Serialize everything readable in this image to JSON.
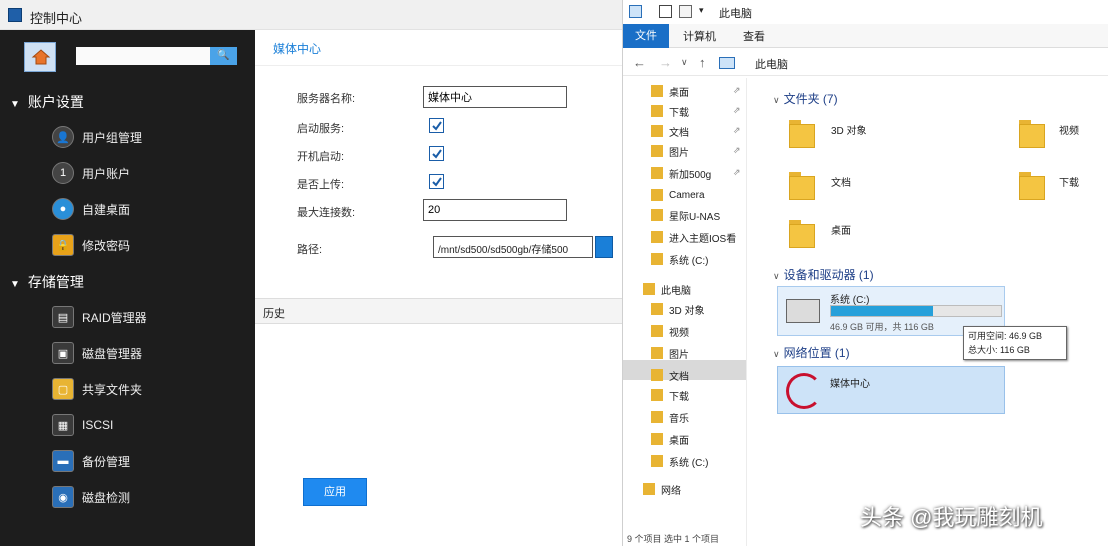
{
  "left_window": {
    "title": "控制中心",
    "search": {
      "placeholder": "",
      "button_label": "🔍"
    },
    "sections": [
      {
        "label": "账户设置",
        "items": [
          "用户组管理",
          "用户账户",
          "自建桌面",
          "修改密码"
        ]
      },
      {
        "label": "存储管理",
        "items": [
          "RAID管理器",
          "磁盘管理器",
          "共享文件夹",
          "ISCSI",
          "备份管理",
          "磁盘检测"
        ]
      }
    ],
    "main": {
      "tab": "媒体中心",
      "fields": [
        {
          "label": "服务器名称:",
          "value": "媒体中心"
        },
        {
          "label": "启动服务:",
          "checked": true
        },
        {
          "label": "开机启动:",
          "checked": true
        },
        {
          "label": "是否上传:",
          "checked": true
        },
        {
          "label": "最大连接数:",
          "value": "20"
        },
        {
          "label": "路径:",
          "value": "/mnt/sd500/sd500gb/存储500"
        }
      ],
      "history_label": "历史",
      "ok_label": "应用"
    }
  },
  "right_window": {
    "title": "此电脑",
    "ribbon": {
      "file": "文件",
      "tabs": [
        "计算机",
        "查看"
      ]
    },
    "breadcrumb": "此电脑",
    "nav_items": [
      {
        "label": "桌面",
        "pinned": true
      },
      {
        "label": "下载",
        "pinned": true
      },
      {
        "label": "文档",
        "pinned": true
      },
      {
        "label": "图片",
        "pinned": true
      },
      {
        "label": "新加500g",
        "pinned": true
      },
      {
        "label": "Camera",
        "pinned": false
      },
      {
        "label": "星际U-NAS",
        "pinned": false
      },
      {
        "label": "进入主题IOS看",
        "pinned": false
      },
      {
        "label": "系统 (C:)",
        "pinned": false
      },
      {
        "label": "此电脑",
        "pinned": false
      },
      {
        "label": "3D 对象",
        "pinned": false
      },
      {
        "label": "视频",
        "pinned": false
      },
      {
        "label": "图片",
        "pinned": false
      },
      {
        "label": "文档",
        "pinned": false
      },
      {
        "label": "下载",
        "pinned": false
      },
      {
        "label": "音乐",
        "pinned": false
      },
      {
        "label": "桌面",
        "pinned": false
      },
      {
        "label": "系统 (C:)",
        "pinned": false
      },
      {
        "label": "网络",
        "pinned": false
      }
    ],
    "groups": {
      "folders": "文件夹 (7)",
      "devices": "设备和驱动器 (1)",
      "network": "网络位置 (1)"
    },
    "folders": [
      "3D 对象",
      "视频",
      "文档",
      "下载",
      "桌面"
    ],
    "drive": {
      "name": "系统 (C:)",
      "info": "46.9 GB 可用，共 116 GB",
      "used_fraction": 0.6
    },
    "tooltip": {
      "line1": "可用空间: 46.9 GB",
      "line2": "总大小: 116 GB"
    },
    "network_item": "媒体中心",
    "status": "9 个项目   选中 1 个项目"
  },
  "watermark": "头条 @我玩雕刻机",
  "colors": {
    "accent": "#1a7fd8",
    "sidebar": "#1d1d1d",
    "file_tab": "#1a6fc7",
    "drive_bar": "#26a0da"
  }
}
